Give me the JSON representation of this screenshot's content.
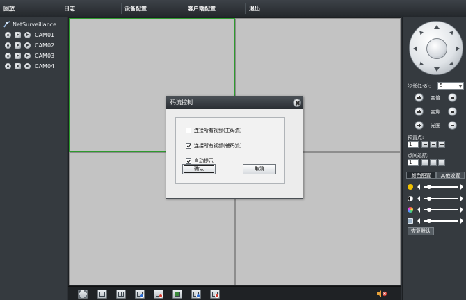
{
  "menu": {
    "items": [
      "回放",
      "日志",
      "设备配置",
      "客户端配置",
      "退出"
    ]
  },
  "device_tree": {
    "root_label": "NetSurveillance",
    "cameras": [
      "CAM01",
      "CAM02",
      "CAM03",
      "CAM04"
    ]
  },
  "video": {
    "layout": "2x2",
    "active_cell": 1
  },
  "ptz": {
    "step_label": "步长(1-8):",
    "step_value": "5",
    "zoom_label": "变倍",
    "focus_label": "变焦",
    "iris_label": "光圈",
    "preset_label": "预置点:",
    "preset_value": "1",
    "cruise_label": "点间巡航:",
    "cruise_value": "1"
  },
  "image_settings": {
    "tabs": [
      "颜色配置",
      "其他设置"
    ],
    "active_tab": 0,
    "restore_label": "恢复默认",
    "sliders": [
      {
        "icon": "brightness-icon",
        "color": "#f2c200",
        "level": 0.1
      },
      {
        "icon": "contrast-icon",
        "color": "#ffffff",
        "level": 0.1
      },
      {
        "icon": "saturation-icon",
        "color": "#e04fb0",
        "level": 0.1
      },
      {
        "icon": "hue-icon",
        "color": "#9fb4c8",
        "level": 0.1
      }
    ]
  },
  "dialog": {
    "title": "码流控制",
    "options": [
      {
        "label": "连接所有视频(主码流)",
        "checked": false
      },
      {
        "label": "连接所有视频(辅码流)",
        "checked": true
      },
      {
        "label": "自动提示",
        "checked": true
      }
    ],
    "confirm_label": "确认",
    "cancel_label": "取消"
  },
  "toolbar": {
    "buttons": [
      "fullscreen-icon",
      "single-view-icon",
      "quad-view-icon",
      "record-all-icon",
      "stop-record-icon",
      "screenshot-icon",
      "connect-all-icon",
      "disconnect-all-icon",
      "volume-icon"
    ]
  }
}
